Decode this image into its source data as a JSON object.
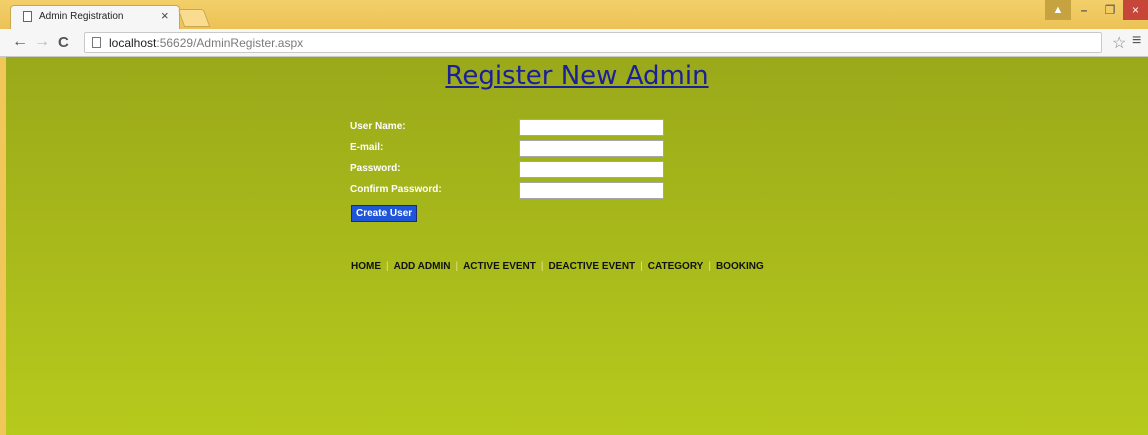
{
  "browser": {
    "tab_title": "Admin Registration",
    "tab_close": "×",
    "url_host": "localhost",
    "url_rest": ":56629/AdminRegister.aspx",
    "icons": {
      "back": "←",
      "forward": "→",
      "reload": "C",
      "star": "☆",
      "menu": "≡",
      "user": "▲",
      "min": "–",
      "max": "❐",
      "close": "×"
    }
  },
  "page": {
    "title": "Register New Admin",
    "form": {
      "fields": [
        {
          "label": "User Name:",
          "value": ""
        },
        {
          "label": "E-mail:",
          "value": ""
        },
        {
          "label": "Password:",
          "value": ""
        },
        {
          "label": "Confirm Password:",
          "value": ""
        }
      ],
      "submit_label": "Create User"
    },
    "nav": [
      "HOME",
      "ADD ADMIN",
      "ACTIVE EVENT",
      "DEACTIVE EVENT",
      "CATEGORY",
      "BOOKING"
    ],
    "nav_separator": "|"
  },
  "colors": {
    "page_bg_top": "#9aa91a",
    "page_bg_bottom": "#b6ca1c",
    "title_link": "#1a1f9c",
    "button": "#1f55d8"
  }
}
